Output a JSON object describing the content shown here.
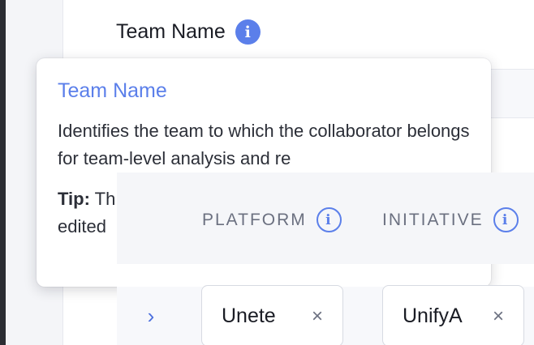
{
  "field": {
    "label": "Team Name",
    "info_icon": "info-icon"
  },
  "tooltip": {
    "title": "Team Name",
    "body": "Identifies the team to which the collaborator belongs for team-level analysis and re",
    "tip_label": "Tip:",
    "tip_text_line1": " Th",
    "tip_text_line2": "edited"
  },
  "table": {
    "columns": [
      {
        "label": "PLATFORM",
        "info_icon": "info-icon"
      },
      {
        "label": "INITIATIVE",
        "info_icon": "info-icon"
      }
    ],
    "row": {
      "expand_icon": "chevron-right-icon",
      "platform_chip": {
        "value": "Unete",
        "remove_glyph": "×"
      },
      "initiative_chip": {
        "value": "UnifyA",
        "remove_glyph": "×"
      }
    }
  },
  "colors": {
    "accent": "#5b7fea",
    "header_text": "#6b7080",
    "header_bg": "#f5f6f9"
  }
}
